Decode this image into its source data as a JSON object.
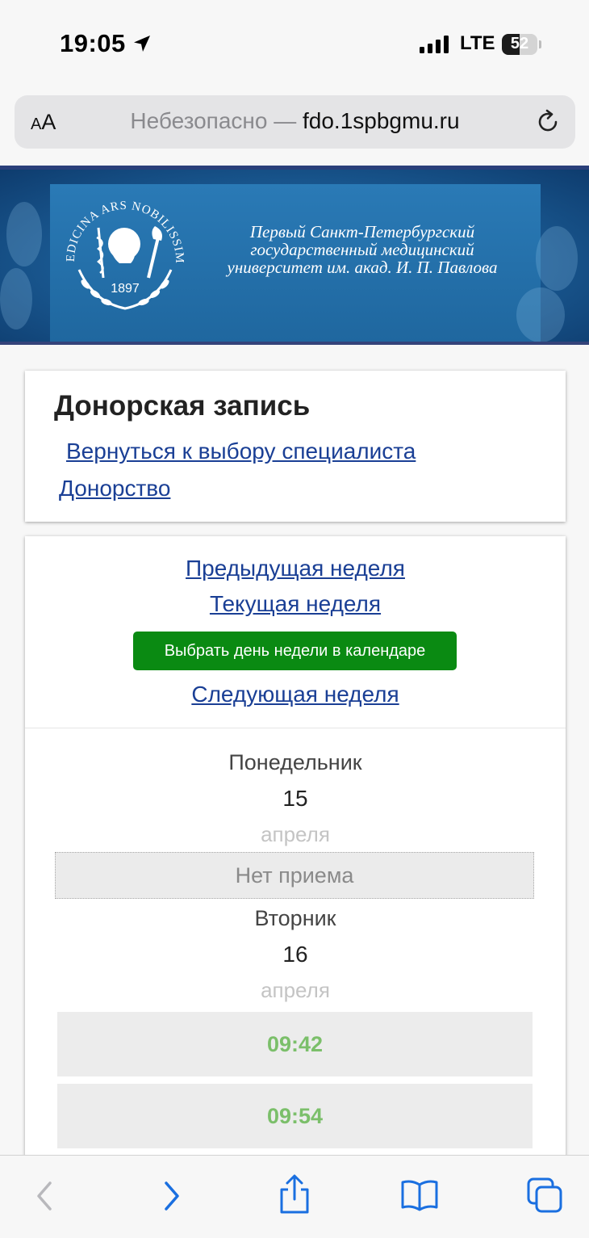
{
  "status_bar": {
    "time": "19:05",
    "network": "LTE",
    "battery": "52",
    "battery_level": 0.52
  },
  "browser": {
    "text_size_label_small": "A",
    "text_size_label_big": "A",
    "security_text": "Небезопасно —",
    "domain": "fdo.1spbgmu.ru"
  },
  "banner": {
    "logo_motto": "MEDICINA ARS NOBILISSIMA",
    "logo_year": "1897",
    "university_name_line1": "Первый Санкт-Петербургский",
    "university_name_line2": "государственный медицинский",
    "university_name_line3": "университет им. акад. И. П. Павлова"
  },
  "header_card": {
    "title": "Донорская запись",
    "back_link": "Вернуться к выбору специалиста",
    "donor_link": "Донорство"
  },
  "schedule": {
    "prev_week": "Предыдущая неделя",
    "current_week": "Текущая неделя",
    "calendar_button": "Выбрать день недели в календаре",
    "next_week": "Следующая неделя",
    "days": [
      {
        "name": "Понедельник",
        "day": "15",
        "month": "апреля",
        "status": "Нет приема"
      },
      {
        "name": "Вторник",
        "day": "16",
        "month": "апреля",
        "slots": [
          "09:42",
          "09:54"
        ]
      }
    ]
  },
  "colors": {
    "link": "#1a3f95",
    "calendar_button": "#0a8a12",
    "slot_time": "#7bbf6a",
    "banner": "#1c5f99"
  },
  "icons": [
    "location-arrow-icon",
    "cellular-signal-icon",
    "battery-icon",
    "reload-icon",
    "back-icon",
    "forward-icon",
    "share-icon",
    "bookmarks-icon",
    "tabs-icon"
  ]
}
